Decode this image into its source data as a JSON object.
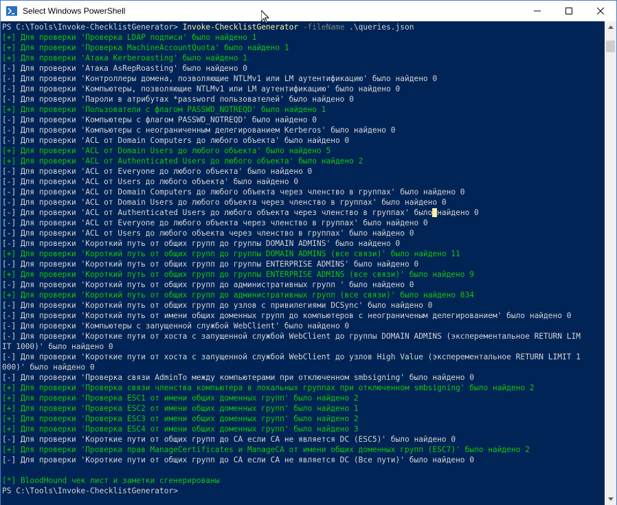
{
  "window": {
    "title": "Select Windows PowerShell",
    "controls": [
      "minimize-icon",
      "maximize-icon",
      "close-icon"
    ]
  },
  "console": {
    "prompt": "PS C:\\Tools\\Invoke-ChecklistGenerator> ",
    "command": "Invoke-ChecklistGenerator",
    "param": " -fileName",
    "arg": " .\\queries.json",
    "lines": [
      {
        "text": "[+] Для проверки 'Проверка LDAP подписи' было найдено 1",
        "green": true
      },
      {
        "text": "[+] Для проверки 'Проверка MachineAccountQuota' было найдено 1",
        "green": true
      },
      {
        "text": "[+] Для проверки 'Атака Kerberoasting' было найдено 1",
        "green": true
      },
      {
        "text": "[-] Для проверки 'Атака AsRepRoasting' было найдено 0",
        "green": false
      },
      {
        "text": "[-] Для проверки 'Контроллеры домена, позволяющие NTLMv1 или LM аутентификацию' было найдено 0",
        "green": false
      },
      {
        "text": "[-] Для проверки 'Компьютеры, позволяющие NTLMv1 или LM аутентификацию' было найдено 0",
        "green": false
      },
      {
        "text": "[-] Для проверки 'Пароли в атрибутах *password пользователей' было найдено 0",
        "green": false
      },
      {
        "text": "[+] Для проверки 'Пользователи с флагом PASSWD_NOTREQD' было найдено 1",
        "green": true
      },
      {
        "text": "[-] Для проверки 'Компьютеры с флагом PASSWD_NOTREQD' было найдено 0",
        "green": false
      },
      {
        "text": "[-] Для проверки 'Компьютеры с неограниченным делегированием Kerberos' было найдено 0",
        "green": false
      },
      {
        "text": "[-] Для проверки 'ACL от Domain Computers до любого объекта' было найдено 0",
        "green": false
      },
      {
        "text": "[+] Для проверки 'ACL от Domain Users до любого объекта' было найдено 5",
        "green": true
      },
      {
        "text": "[+] Для проверки 'ACL от Authenticated Users до любого объекта' было найдено 2",
        "green": true
      },
      {
        "text": "[-] Для проверки 'ACL от Everyone до любого объекта' было найдено 0",
        "green": false
      },
      {
        "text": "[-] Для проверки 'ACL от Users до любого объекта' было найдено 0",
        "green": false
      },
      {
        "text": "[-] Для проверки 'ACL от Domain Computers до любого объекта через членство в группах' было найдено 0",
        "green": false
      },
      {
        "text": "[-] Для проверки 'ACL от Domain Users до любого объекта через членство в группах' было найдено 0",
        "green": false
      },
      {
        "text": "[-] Для проверки 'ACL от Authenticated Users до любого объекта через членство в группах' было найдено 0",
        "green": false,
        "cursor_at": 93
      },
      {
        "text": "[-] Для проверки 'ACL от Everyone до любого объекта через членство в группах' было найдено 0",
        "green": false
      },
      {
        "text": "[-] Для проверки 'ACL от Users до любого объекта через членство в группах' было найдено 0",
        "green": false
      },
      {
        "text": "[-] Для проверки 'Короткий путь от общих групп до группы DOMAIN ADMINS' было найдено 0",
        "green": false
      },
      {
        "text": "[+] Для проверки 'Короткий путь от общих групп до группы DOMAIN ADMINS (все связи)' было найдено 11",
        "green": true
      },
      {
        "text": "[-] Для проверки 'Короткий путь от общих групп до группы ENTERPRISE ADMINS' было найдено 0",
        "green": false
      },
      {
        "text": "[+] Для проверки 'Короткий путь от общих групп до группы ENTERPRISE ADMINS (все связи)' было найдено 9",
        "green": true
      },
      {
        "text": "[-] Для проверки 'Короткий путь от общих групп до административных групп ' было найдено 0",
        "green": false
      },
      {
        "text": "[+] Для проверки 'Короткий путь от общих групп до административных групп (все связи)' было найдено 834",
        "green": true
      },
      {
        "text": "[-] Для проверки 'Короткий путь от общих групп до узлов с привилегиями DCSync' было найдено 0",
        "green": false
      },
      {
        "text": "[-] Для проверки 'Короткий путь от имени общих доменных групп до компьютеров с неограниченым делегированием' было найдено 0",
        "green": false
      },
      {
        "text": "[-] Для проверки 'Компьютеры с запущенной службой WebClient' было найдено 0",
        "green": false
      },
      {
        "text": "[-] Для проверки 'Короткие пути от хоста с запущенной службой WebClient до группы DOMAIN ADMINS (эксперементальное RETURN LIM",
        "green": false
      },
      {
        "text": "IT 1000)' было найдено 0",
        "green": false
      },
      {
        "text": "[-] Для проверки 'Короткие пути от хоста с запущенной службой WebClient до узлов High Value (эксперементальное RETURN LIMIT 1",
        "green": false
      },
      {
        "text": "000)' было найдено 0",
        "green": false
      },
      {
        "text": "[-] Для проверки 'Проверка связи AdminTo между компьютерами при отключенном smbsigning' было найдено 0",
        "green": false
      },
      {
        "text": "[+] Для проверки 'Проверка связи членства компьютера в локальных группах при отключенном smbsigning' было найдено 2",
        "green": true
      },
      {
        "text": "[+] Для проверки 'Проверка ESC1 от имени общих доменных групп' было найдено 2",
        "green": true
      },
      {
        "text": "[+] Для проверки 'Проверка ESC2 от имени общих доменных групп' было найдено 1",
        "green": true
      },
      {
        "text": "[+] Для проверки 'Проверка ESC3 от имени общих доменных групп' было найдено 2",
        "green": true
      },
      {
        "text": "[+] Для проверки 'Проверка ESC4 от имени общих доменных групп' было найдено 3",
        "green": true
      },
      {
        "text": "[-] Для проверки 'Короткие пути от общих групп до CA если CA не является DC (ESC5)' было найдено 0",
        "green": false
      },
      {
        "text": "[+] Для проверки 'Проверка прав ManageCertificates и ManageCA от имени общих доменных групп (ESC7)' было найдено 2",
        "green": true
      },
      {
        "text": "[-] Для проверки 'Короткие пути от общих групп до CA если CA не является DC (Все пути)' было найдено 0",
        "green": false
      },
      {
        "text": "",
        "green": false
      },
      {
        "text": "[*] BloodHound чек лист и заметки сгенерированы",
        "green": true
      },
      {
        "text": "PS C:\\Tools\\Invoke-ChecklistGenerator>",
        "green": false
      }
    ]
  },
  "colors": {
    "background": "#012456",
    "text": "#d4d4d4",
    "success": "#16c60c",
    "command": "#f9f1a5",
    "parameter": "#808080"
  }
}
